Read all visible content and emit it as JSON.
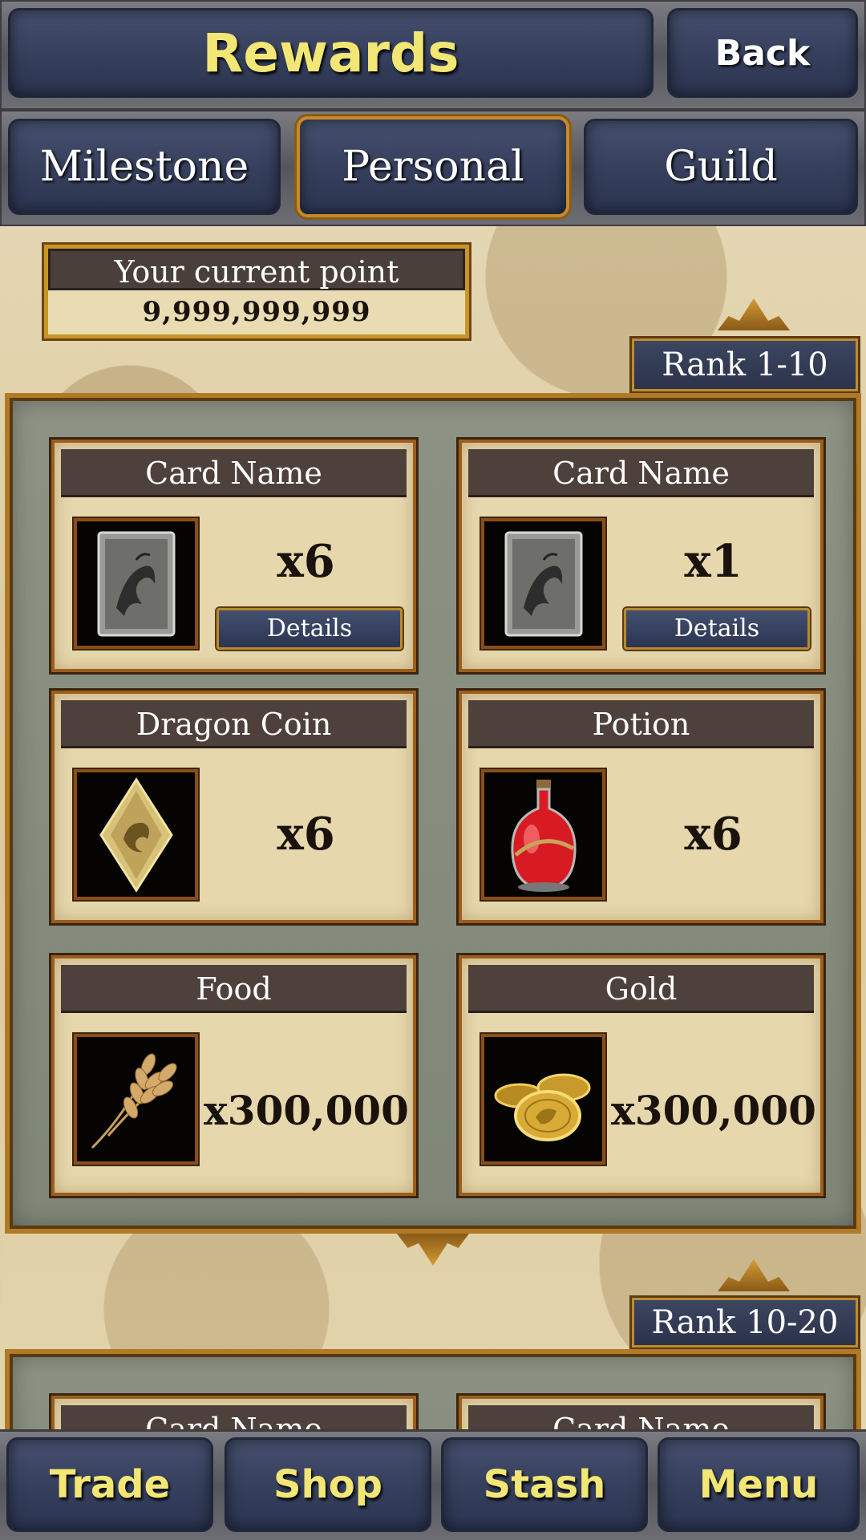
{
  "header": {
    "title": "Rewards",
    "back_label": "Back"
  },
  "tabs": [
    {
      "label": "Milestone",
      "active": false
    },
    {
      "label": "Personal",
      "active": true
    },
    {
      "label": "Guild",
      "active": false
    }
  ],
  "points": {
    "label": "Your current point",
    "value": "9,999,999,999"
  },
  "ranks": [
    {
      "label": "Rank 1-10",
      "rewards": [
        {
          "name": "Card Name",
          "qty": "x6",
          "icon": "dragon-card-icon",
          "details_label": "Details"
        },
        {
          "name": "Card Name",
          "qty": "x1",
          "icon": "dragon-card-icon",
          "details_label": "Details"
        },
        {
          "name": "Dragon Coin",
          "qty": "x6",
          "icon": "dragon-coin-icon"
        },
        {
          "name": "Potion",
          "qty": "x6",
          "icon": "potion-icon"
        },
        {
          "name": "Food",
          "qty": "x300,000",
          "icon": "wheat-icon"
        },
        {
          "name": "Gold",
          "qty": "x300,000",
          "icon": "gold-coins-icon"
        }
      ]
    },
    {
      "label": "Rank 10-20",
      "rewards": [
        {
          "name": "Card Name"
        },
        {
          "name": "Card Name"
        }
      ]
    }
  ],
  "bottom_nav": [
    {
      "label": "Trade"
    },
    {
      "label": "Shop"
    },
    {
      "label": "Stash"
    },
    {
      "label": "Menu"
    }
  ],
  "colors": {
    "title_yellow": "#f2e675",
    "navy_plate": "#353f5c",
    "gold_frame": "#c58a2c",
    "parchment": "#e6d7ac",
    "card_header": "#4e413c"
  }
}
